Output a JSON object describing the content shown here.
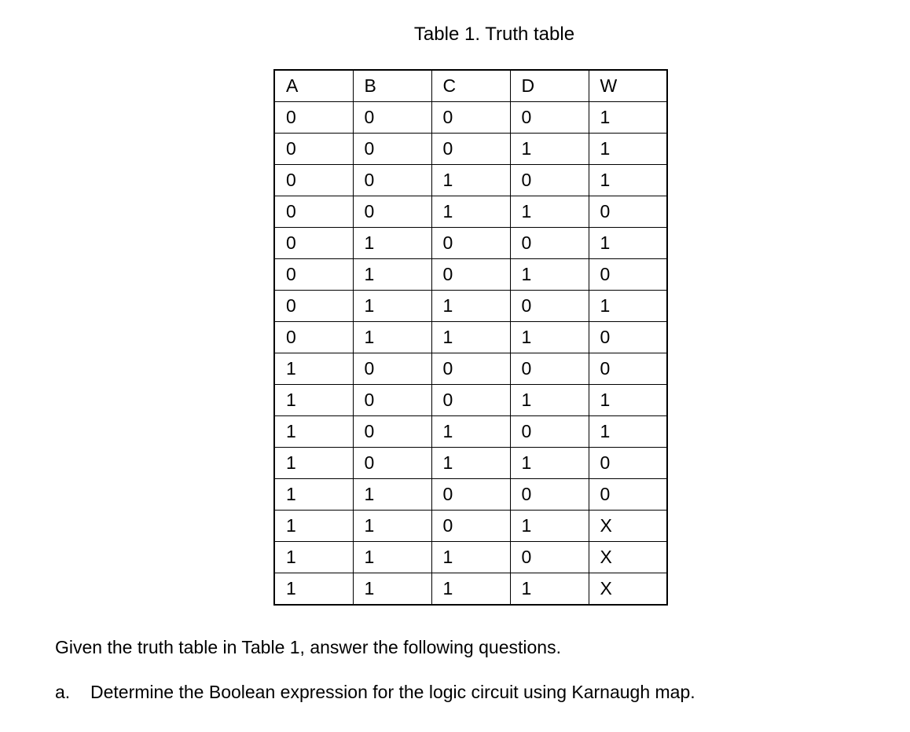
{
  "title": "Table 1. Truth table",
  "table": {
    "headers": [
      "A",
      "B",
      "C",
      "D",
      "W"
    ],
    "rows": [
      [
        "0",
        "0",
        "0",
        "0",
        "1"
      ],
      [
        "0",
        "0",
        "0",
        "1",
        "1"
      ],
      [
        "0",
        "0",
        "1",
        "0",
        "1"
      ],
      [
        "0",
        "0",
        "1",
        "1",
        "0"
      ],
      [
        "0",
        "1",
        "0",
        "0",
        "1"
      ],
      [
        "0",
        "1",
        "0",
        "1",
        "0"
      ],
      [
        "0",
        "1",
        "1",
        "0",
        "1"
      ],
      [
        "0",
        "1",
        "1",
        "1",
        "0"
      ],
      [
        "1",
        "0",
        "0",
        "0",
        "0"
      ],
      [
        "1",
        "0",
        "0",
        "1",
        "1"
      ],
      [
        "1",
        "0",
        "1",
        "0",
        "1"
      ],
      [
        "1",
        "0",
        "1",
        "1",
        "0"
      ],
      [
        "1",
        "1",
        "0",
        "0",
        "0"
      ],
      [
        "1",
        "1",
        "0",
        "1",
        "X"
      ],
      [
        "1",
        "1",
        "1",
        "0",
        "X"
      ],
      [
        "1",
        "1",
        "1",
        "1",
        "X"
      ]
    ]
  },
  "instruction": "Given the truth table in Table 1, answer the following questions.",
  "questions": {
    "a": {
      "label": "a.",
      "text": "Determine the Boolean expression for the logic circuit using Karnaugh map."
    }
  },
  "chart_data": {
    "type": "table",
    "title": "Table 1. Truth table",
    "columns": [
      "A",
      "B",
      "C",
      "D",
      "W"
    ],
    "data": [
      {
        "A": 0,
        "B": 0,
        "C": 0,
        "D": 0,
        "W": "1"
      },
      {
        "A": 0,
        "B": 0,
        "C": 0,
        "D": 1,
        "W": "1"
      },
      {
        "A": 0,
        "B": 0,
        "C": 1,
        "D": 0,
        "W": "1"
      },
      {
        "A": 0,
        "B": 0,
        "C": 1,
        "D": 1,
        "W": "0"
      },
      {
        "A": 0,
        "B": 1,
        "C": 0,
        "D": 0,
        "W": "1"
      },
      {
        "A": 0,
        "B": 1,
        "C": 0,
        "D": 1,
        "W": "0"
      },
      {
        "A": 0,
        "B": 1,
        "C": 1,
        "D": 0,
        "W": "1"
      },
      {
        "A": 0,
        "B": 1,
        "C": 1,
        "D": 1,
        "W": "0"
      },
      {
        "A": 1,
        "B": 0,
        "C": 0,
        "D": 0,
        "W": "0"
      },
      {
        "A": 1,
        "B": 0,
        "C": 0,
        "D": 1,
        "W": "1"
      },
      {
        "A": 1,
        "B": 0,
        "C": 1,
        "D": 0,
        "W": "1"
      },
      {
        "A": 1,
        "B": 0,
        "C": 1,
        "D": 1,
        "W": "0"
      },
      {
        "A": 1,
        "B": 1,
        "C": 0,
        "D": 0,
        "W": "0"
      },
      {
        "A": 1,
        "B": 1,
        "C": 0,
        "D": 1,
        "W": "X"
      },
      {
        "A": 1,
        "B": 1,
        "C": 1,
        "D": 0,
        "W": "X"
      },
      {
        "A": 1,
        "B": 1,
        "C": 1,
        "D": 1,
        "W": "X"
      }
    ]
  }
}
